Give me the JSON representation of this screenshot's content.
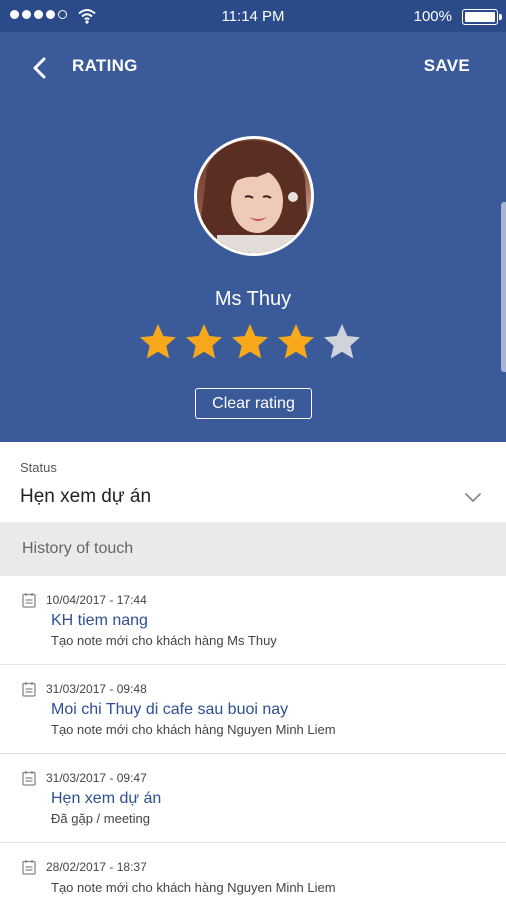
{
  "status_bar": {
    "time": "11:14 PM",
    "battery": "100%",
    "signal_bars_filled": 4,
    "signal_bars_total": 5
  },
  "header": {
    "title": "RATING",
    "save_label": "SAVE"
  },
  "profile": {
    "name": "Ms Thuy",
    "rating": 4,
    "max_rating": 5,
    "clear_label": "Clear rating"
  },
  "colors": {
    "header_bg": "#3b5a99",
    "status_bar_bg": "#2a4a8a",
    "star_active": "#f7a81b",
    "star_inactive": "#cfd3da",
    "link_blue": "#2f4f94"
  },
  "status": {
    "label": "Status",
    "value": "Hẹn xem dự án"
  },
  "history": {
    "label": "History of touch",
    "items": [
      {
        "date": "10/04/2017 - 17:44",
        "subject": "KH tiem nang",
        "note": "Tạo note mới cho khách hàng Ms Thuy"
      },
      {
        "date": "31/03/2017 - 09:48",
        "subject": "Moi chi Thuy di cafe sau buoi nay",
        "note": "Tạo note mới cho khách hàng Nguyen Minh Liem"
      },
      {
        "date": "31/03/2017 - 09:47",
        "subject": "Hẹn xem dự án",
        "note": "Đã gặp / meeting"
      },
      {
        "date": "28/02/2017 - 18:37",
        "subject": "",
        "note": "Tạo note mới cho khách hàng Nguyen Minh Liem"
      }
    ]
  },
  "icons": {
    "back": "chevron-left-icon",
    "status_expand": "chevron-down-icon",
    "history_item": "calendar-icon",
    "rating": "star-icon"
  }
}
